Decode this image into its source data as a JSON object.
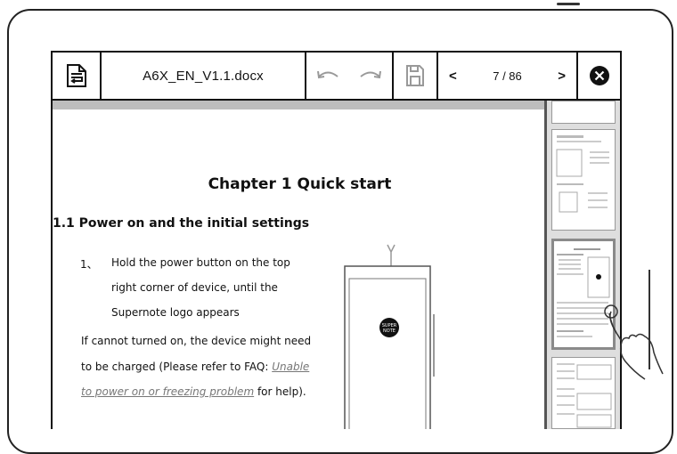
{
  "toolbar": {
    "file_name": "A6X_EN_V1.1.docx",
    "page_indicator": "7 / 86",
    "prev_label": "<",
    "next_label": ">"
  },
  "document": {
    "chapter_title": "Chapter 1 Quick start",
    "section_title": "1.1 Power on and the initial settings",
    "step_number": "1、",
    "step_lines": [
      "Hold the power button on the top",
      "right corner of device, until the",
      "Supernote logo appears"
    ],
    "para_line1": "If cannot turned on, the device might need",
    "para_line2_prefix": "to be charged (Please refer to FAQ: ",
    "para_link_part1": "Unable",
    "para_link_part2": "to power on or freezing problem",
    "para_line3_suffix": " for help).",
    "logo_text": "SUPER NOTE"
  },
  "sidebar": {
    "selected_thumb_title": "Chapter 1 Quick start"
  },
  "colors": {
    "border": "#111111",
    "page_header": "#bdbdbd",
    "sidebar_bg": "#dedede",
    "link": "#777777"
  }
}
